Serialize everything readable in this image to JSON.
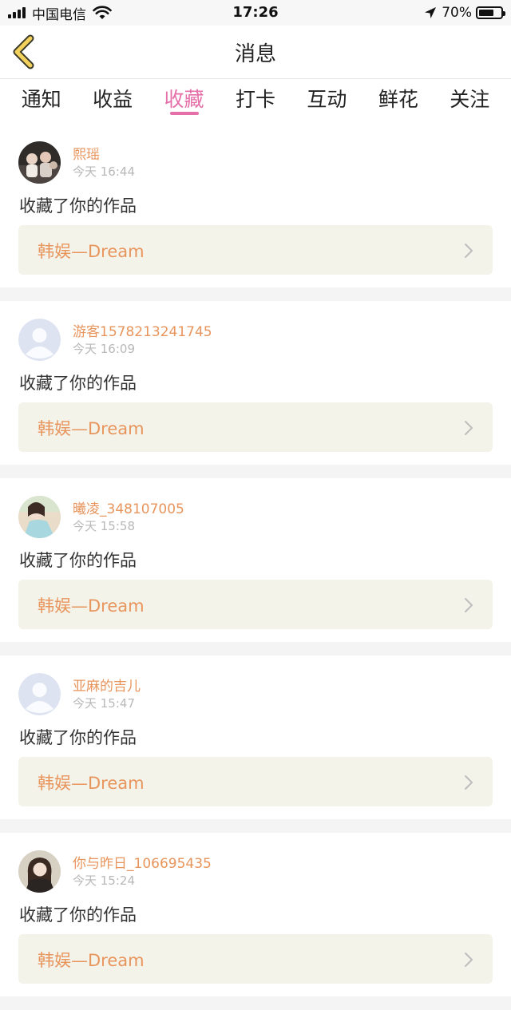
{
  "status_bar": {
    "carrier": "中国电信",
    "time": "17:26",
    "battery_percent": "70%",
    "battery_level": 0.7
  },
  "nav": {
    "title": "消息"
  },
  "tabs": [
    {
      "label": "通知",
      "active": false
    },
    {
      "label": "收益",
      "active": false
    },
    {
      "label": "收藏",
      "active": true
    },
    {
      "label": "打卡",
      "active": false
    },
    {
      "label": "互动",
      "active": false
    },
    {
      "label": "鲜花",
      "active": false
    },
    {
      "label": "关注",
      "active": false
    }
  ],
  "notifications": [
    {
      "username": "熙瑶",
      "time": "今天 16:44",
      "action": "收藏了你的作品",
      "work": "韩娱—Dream",
      "avatar": "photo-avatar-group"
    },
    {
      "username": "游客1578213241745",
      "time": "今天 16:09",
      "action": "收藏了你的作品",
      "work": "韩娱—Dream",
      "avatar": "default-avatar"
    },
    {
      "username": "曦凌_348107005",
      "time": "今天 15:58",
      "action": "收藏了你的作品",
      "work": "韩娱—Dream",
      "avatar": "photo-avatar-girl"
    },
    {
      "username": "亚麻的吉儿",
      "time": "今天 15:47",
      "action": "收藏了你的作品",
      "work": "韩娱—Dream",
      "avatar": "default-avatar"
    },
    {
      "username": "你与昨日_106695435",
      "time": "今天 15:24",
      "action": "收藏了你的作品",
      "work": "韩娱—Dream",
      "avatar": "photo-avatar-woman"
    }
  ],
  "colors": {
    "accent_pink": "#e56fa8",
    "username_orange": "#e8955d",
    "work_card_bg": "#f3f3ea",
    "back_arrow": "#f2d25c"
  }
}
